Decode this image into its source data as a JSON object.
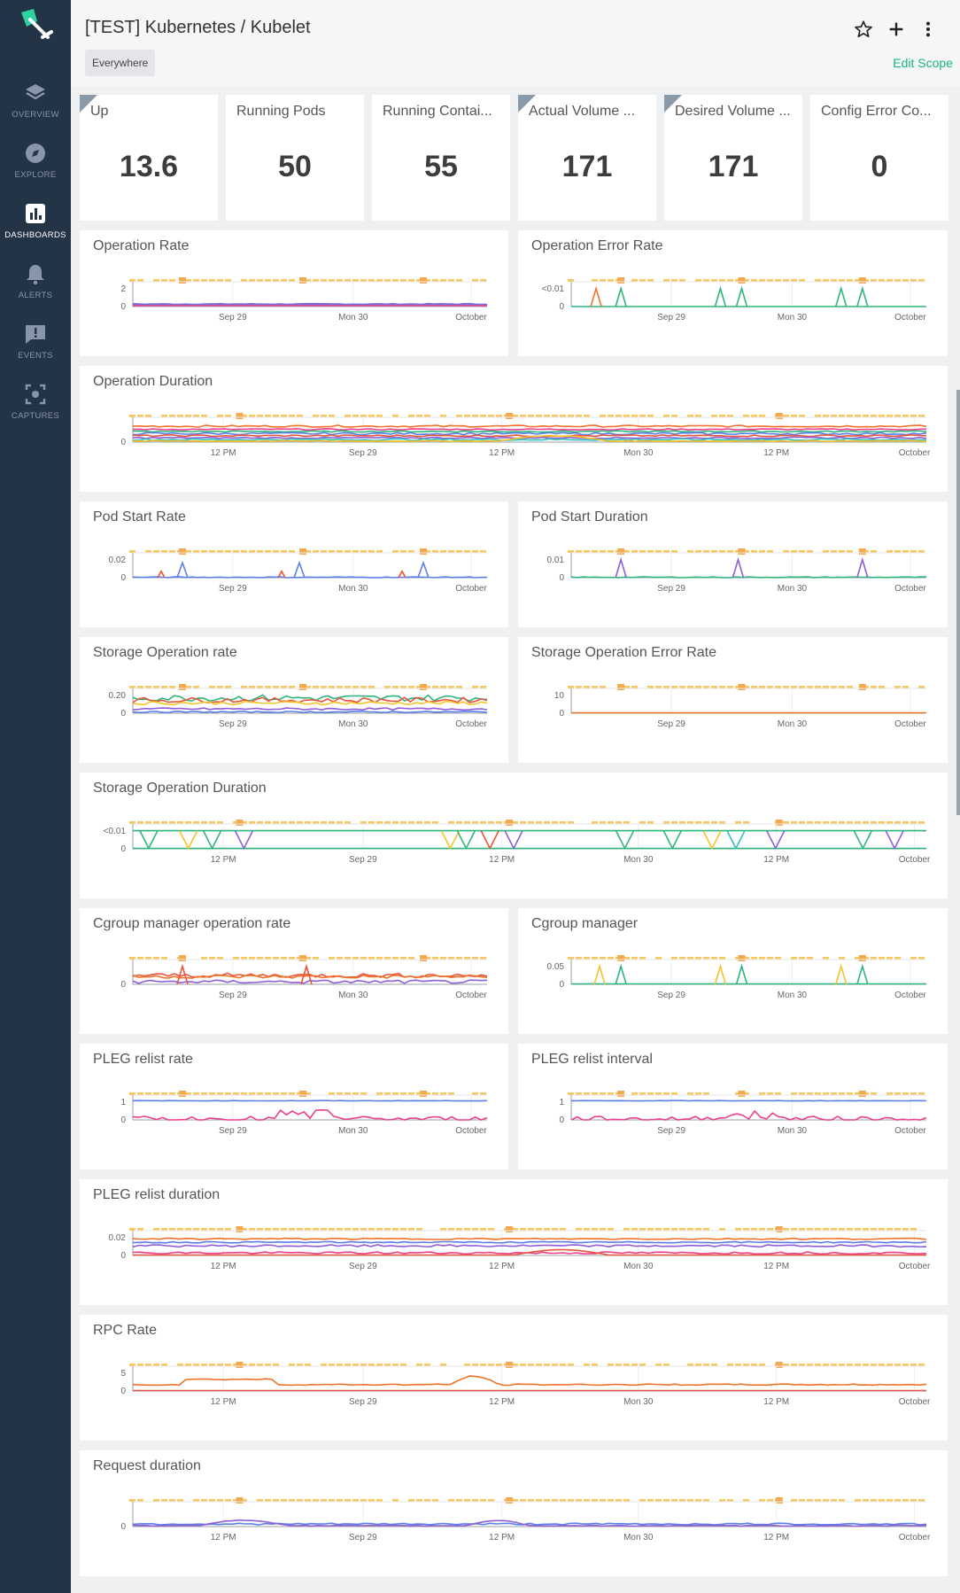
{
  "app": {
    "title": "[TEST] Kubernetes / Kubelet",
    "scope": "Everywhere",
    "edit_scope": "Edit Scope"
  },
  "colors": {
    "sidebar_bg": "#243447",
    "accent": "#1ab57a",
    "events_marker": "#f7c760",
    "events_marker_strong": "#f4a94e"
  },
  "sidebar": {
    "items": [
      {
        "label": "OVERVIEW",
        "icon": "layers-icon"
      },
      {
        "label": "EXPLORE",
        "icon": "compass-icon"
      },
      {
        "label": "DASHBOARDS",
        "icon": "bar-chart-icon",
        "active": true
      },
      {
        "label": "ALERTS",
        "icon": "bell-icon"
      },
      {
        "label": "EVENTS",
        "icon": "alert-message-icon"
      },
      {
        "label": "CAPTURES",
        "icon": "capture-icon"
      }
    ]
  },
  "kpis": [
    {
      "title": "Up",
      "value": "13.6",
      "corner": true
    },
    {
      "title": "Running Pods",
      "value": "50",
      "corner": false
    },
    {
      "title": "Running Contai...",
      "value": "55",
      "corner": false
    },
    {
      "title": "Actual Volume ...",
      "value": "171",
      "corner": true
    },
    {
      "title": "Desired Volume ...",
      "value": "171",
      "corner": true
    },
    {
      "title": "Config Error Co...",
      "value": "0",
      "corner": false
    }
  ],
  "chart_data": [
    {
      "id": "operation-rate",
      "title": "Operation Rate",
      "type": "line",
      "ytick_labels": [
        "2",
        "0"
      ],
      "xtick_labels": [
        "Sep 29",
        "Mon 30",
        "October"
      ]
    },
    {
      "id": "operation-error-rate",
      "title": "Operation Error Rate",
      "type": "line",
      "ytick_labels": [
        "<0.01",
        "0"
      ],
      "xtick_labels": [
        "Sep 29",
        "Mon 30",
        "October"
      ]
    },
    {
      "id": "operation-duration",
      "title": "Operation Duration",
      "type": "line",
      "ytick_labels": [
        "0"
      ],
      "xtick_labels": [
        "12 PM",
        "Sep 29",
        "12 PM",
        "Mon 30",
        "12 PM",
        "October"
      ]
    },
    {
      "id": "pod-start-rate",
      "title": "Pod Start Rate",
      "type": "line",
      "ytick_labels": [
        "0.02",
        "0"
      ],
      "xtick_labels": [
        "Sep 29",
        "Mon 30",
        "October"
      ]
    },
    {
      "id": "pod-start-duration",
      "title": "Pod Start Duration",
      "type": "line",
      "ytick_labels": [
        "0.01",
        "0"
      ],
      "xtick_labels": [
        "Sep 29",
        "Mon 30",
        "October"
      ]
    },
    {
      "id": "storage-operation-rate",
      "title": "Storage Operation rate",
      "type": "line",
      "ytick_labels": [
        "0.20",
        "0"
      ],
      "xtick_labels": [
        "Sep 29",
        "Mon 30",
        "October"
      ]
    },
    {
      "id": "storage-operation-error-rate",
      "title": "Storage Operation Error Rate",
      "type": "line",
      "ytick_labels": [
        "10",
        "0"
      ],
      "xtick_labels": [
        "Sep 29",
        "Mon 30",
        "October"
      ]
    },
    {
      "id": "storage-operation-duration",
      "title": "Storage Operation Duration",
      "type": "line",
      "ytick_labels": [
        "<0.01",
        "0"
      ],
      "xtick_labels": [
        "12 PM",
        "Sep 29",
        "12 PM",
        "Mon 30",
        "12 PM",
        "October"
      ]
    },
    {
      "id": "cgroup-manager-operation-rate",
      "title": "Cgroup manager operation rate",
      "type": "line",
      "ytick_labels": [
        "0"
      ],
      "xtick_labels": [
        "Sep 29",
        "Mon 30",
        "October"
      ]
    },
    {
      "id": "cgroup-manager",
      "title": "Cgroup manager",
      "type": "line",
      "ytick_labels": [
        "0.05",
        "0"
      ],
      "xtick_labels": [
        "Sep 29",
        "Mon 30",
        "October"
      ]
    },
    {
      "id": "pleg-relist-rate",
      "title": "PLEG relist rate",
      "type": "line",
      "ytick_labels": [
        "1",
        "0"
      ],
      "xtick_labels": [
        "Sep 29",
        "Mon 30",
        "October"
      ]
    },
    {
      "id": "pleg-relist-interval",
      "title": "PLEG relist interval",
      "type": "line",
      "ytick_labels": [
        "1",
        "0"
      ],
      "xtick_labels": [
        "Sep 29",
        "Mon 30",
        "October"
      ]
    },
    {
      "id": "pleg-relist-duration",
      "title": "PLEG relist duration",
      "type": "line",
      "ytick_labels": [
        "0.02",
        "0"
      ],
      "xtick_labels": [
        "12 PM",
        "Sep 29",
        "12 PM",
        "Mon 30",
        "12 PM",
        "October"
      ]
    },
    {
      "id": "rpc-rate",
      "title": "RPC Rate",
      "type": "line",
      "ytick_labels": [
        "5",
        "0"
      ],
      "xtick_labels": [
        "12 PM",
        "Sep 29",
        "12 PM",
        "Mon 30",
        "12 PM",
        "October"
      ]
    },
    {
      "id": "request-duration",
      "title": "Request duration",
      "type": "line",
      "ytick_labels": [
        "0"
      ],
      "xtick_labels": [
        "12 PM",
        "Sep 29",
        "12 PM",
        "Mon 30",
        "12 PM",
        "October"
      ]
    }
  ]
}
